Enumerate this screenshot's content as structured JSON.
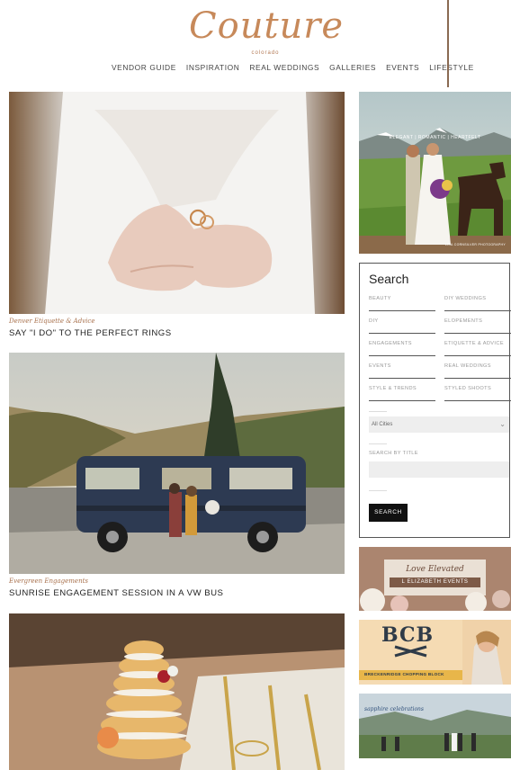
{
  "logo": {
    "script": "Couture",
    "sub": "colorado"
  },
  "nav": [
    "VENDOR GUIDE",
    "INSPIRATION",
    "REAL WEDDINGS",
    "GALLERIES",
    "EVENTS",
    "LIFESTYLE"
  ],
  "posts": [
    {
      "category": "Denver Etiquette & Advice",
      "title": "SAY \"I DO\" TO THE PERFECT RINGS"
    },
    {
      "category": "Evergreen Engagements",
      "title": "SUNRISE ENGAGEMENT SESSION IN A VW BUS"
    }
  ],
  "sidebar": {
    "ad_top": {
      "tagline": "ELEGANT | ROMANTIC | HEARTFELT",
      "credit": "LISA CORNSILVER PHOTOGRAPHY"
    },
    "search": {
      "title": "Search",
      "tags": [
        "BEAUTY",
        "DIY WEDDINGS",
        "DIY",
        "ELOPEMENTS",
        "ENGAGEMENTS",
        "ETIQUETTE & ADVICE",
        "EVENTS",
        "REAL WEDDINGS",
        "STYLE & TRENDS",
        "STYLED SHOOTS"
      ],
      "city_select": "All Cities",
      "title_label": "SEARCH BY TITLE",
      "button": "SEARCH"
    },
    "ads": {
      "love_elevated": {
        "line1": "Love Elevated",
        "line2": "L ELIZABETH EVENTS"
      },
      "bcb": {
        "mark": "BCB",
        "name": "BRECKENRIDGE CHOPPING BLOCK"
      },
      "sapphire": {
        "name": "sapphire celebrations"
      }
    }
  }
}
